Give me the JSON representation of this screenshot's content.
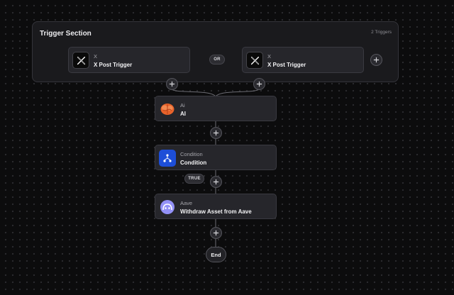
{
  "trigger_section": {
    "title": "Trigger Section",
    "count_label": "2 Triggers",
    "or_label": "OR",
    "triggers": [
      {
        "subtitle": "X",
        "title": "X Post Trigger",
        "icon": "x-logo-icon"
      },
      {
        "subtitle": "X",
        "title": "X Post Trigger",
        "icon": "x-logo-icon"
      }
    ]
  },
  "nodes": [
    {
      "subtitle": "Ai",
      "title": "AI",
      "icon": "brain-icon",
      "icon_color": "#e8632b"
    },
    {
      "subtitle": "Condition",
      "title": "Condition",
      "icon": "branch-icon",
      "icon_color": "#1d4ed8"
    },
    {
      "subtitle": "Aave",
      "title": "Withdraw Asset from Aave",
      "icon": "aave-ghost-icon",
      "icon_color": "#9391f7"
    }
  ],
  "branch_label": "TRUE",
  "end_label": "End",
  "colors": {
    "background": "#0c0c0d",
    "node": "#26262b",
    "border": "#3a3a41"
  }
}
